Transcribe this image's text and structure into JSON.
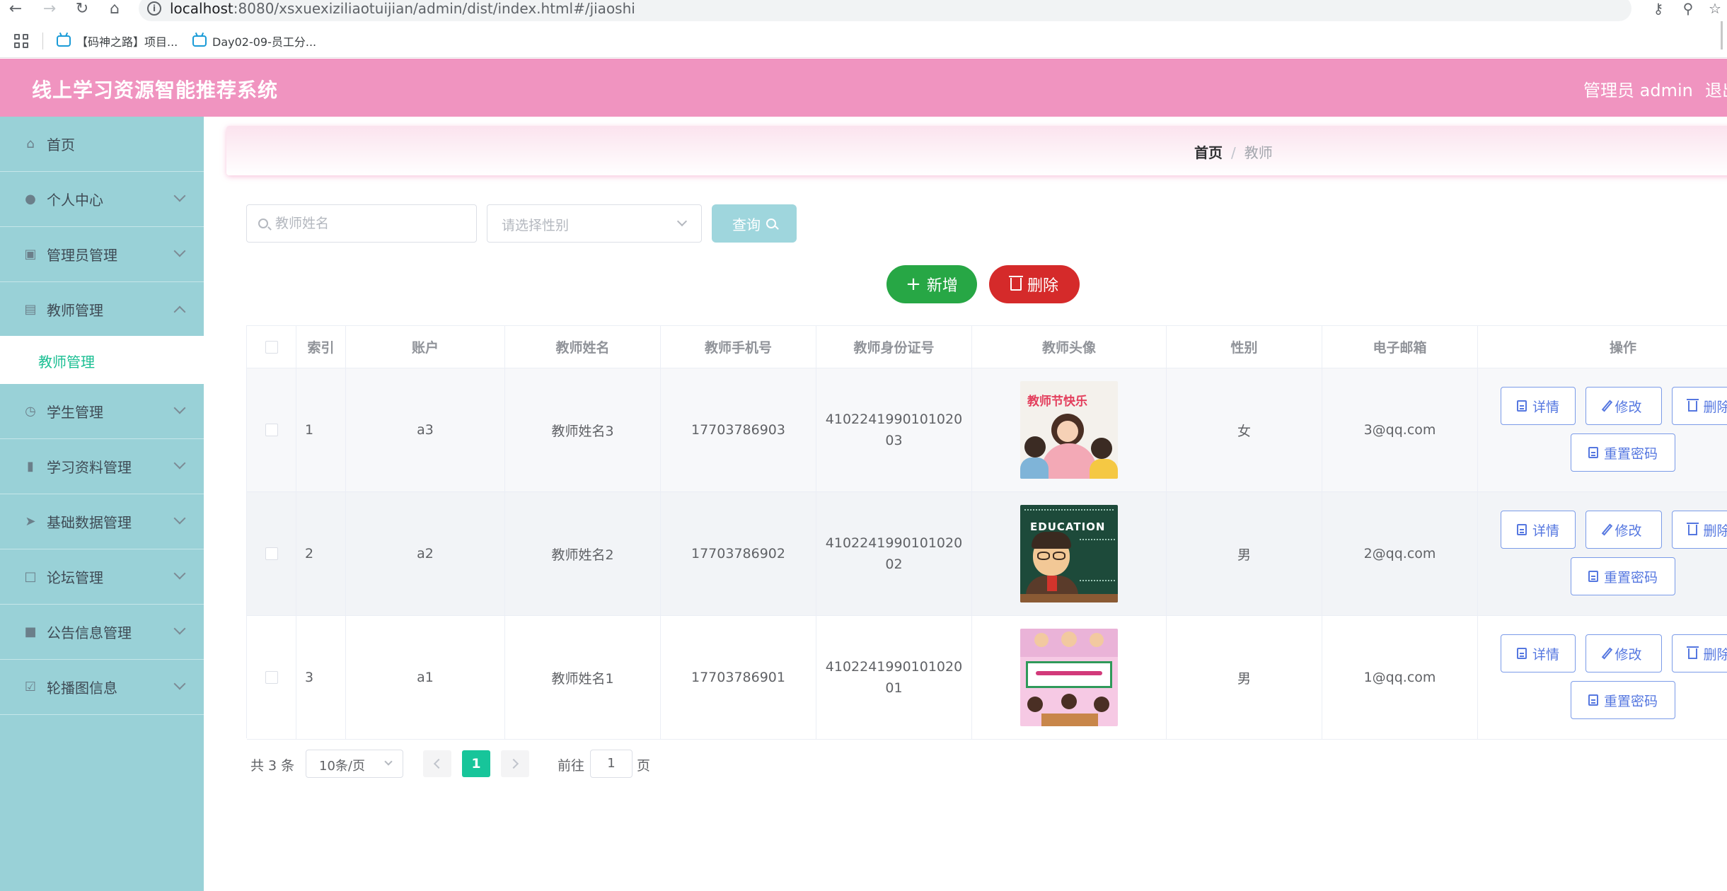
{
  "browser": {
    "url_host": "localhost",
    "url_path": ":8080/xsxuexiziliaotuijian/admin/dist/index.html#/jiaoshi",
    "bookmarks": [
      {
        "label": "【码神之路】项目..."
      },
      {
        "label": "Day02-09-员工分..."
      }
    ]
  },
  "header": {
    "title": "线上学习资源智能推荐系统",
    "admin": "管理员 admin",
    "logout": "退出"
  },
  "sidebar": {
    "items": [
      {
        "label": "首页",
        "icon": "home-icon"
      },
      {
        "label": "个人中心",
        "icon": "user-icon"
      },
      {
        "label": "管理员管理",
        "icon": "briefcase-icon"
      },
      {
        "label": "教师管理",
        "icon": "id-card-icon"
      },
      {
        "label": "学生管理",
        "icon": "clock-icon"
      },
      {
        "label": "学习资料管理",
        "icon": "ticket-icon"
      },
      {
        "label": "基础数据管理",
        "icon": "send-icon"
      },
      {
        "label": "论坛管理",
        "icon": "crop-icon"
      },
      {
        "label": "公告信息管理",
        "icon": "clipboard-icon"
      },
      {
        "label": "轮播图信息",
        "icon": "check-doc-icon"
      }
    ],
    "active_sub": "教师管理"
  },
  "breadcrumb": {
    "home": "首页",
    "separator": "/",
    "current": "教师"
  },
  "search": {
    "name_placeholder": "教师姓名",
    "gender_placeholder": "请选择性别",
    "query_label": "查询"
  },
  "actions": {
    "add_label": "新增",
    "delete_label": "删除"
  },
  "table": {
    "headers": [
      "索引",
      "账户",
      "教师姓名",
      "教师手机号",
      "教师身份证号",
      "教师头像",
      "性别",
      "电子邮箱",
      "操作"
    ],
    "rows": [
      {
        "index": "1",
        "account": "a3",
        "name": "教师姓名3",
        "phone": "17703786903",
        "idno": "410224199010102003",
        "gender": "女",
        "email": "3@qq.com"
      },
      {
        "index": "2",
        "account": "a2",
        "name": "教师姓名2",
        "phone": "17703786902",
        "idno": "410224199010102002",
        "gender": "男",
        "email": "2@qq.com"
      },
      {
        "index": "3",
        "account": "a1",
        "name": "教师姓名1",
        "phone": "17703786901",
        "idno": "410224199010102001",
        "gender": "男",
        "email": "1@qq.com"
      }
    ],
    "avatar_texts": [
      "教师节快乐",
      "EDUCATION"
    ],
    "ops": {
      "detail": "详情",
      "edit": "修改",
      "delete": "删除",
      "reset": "重置密码"
    }
  },
  "pagination": {
    "total": "共 3 条",
    "page_size": "10条/页",
    "current": "1",
    "goto_label": "前往",
    "goto_value": "1",
    "page_suffix": "页"
  },
  "colors": {
    "header": "#f094c0",
    "sidebar": "#99d1d7",
    "add": "#27a745",
    "delete": "#d52a2a",
    "accent": "#17c59a"
  }
}
